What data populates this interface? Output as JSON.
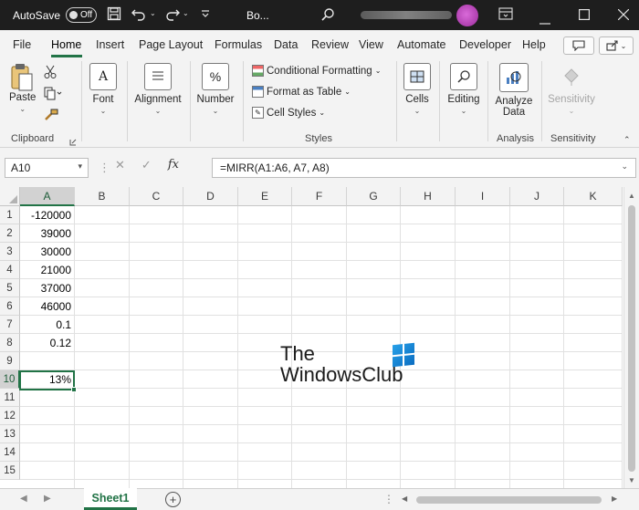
{
  "titlebar": {
    "autosave_label": "AutoSave",
    "autosave_state": "Off",
    "doc_title": "Bo...",
    "icons": [
      "save-icon",
      "undo-icon",
      "redo-icon",
      "customize-icon",
      "search-icon",
      "ribbon-display-icon",
      "minimize-icon",
      "maximize-icon",
      "close-icon"
    ]
  },
  "ribbon_tabs": [
    "File",
    "Home",
    "Insert",
    "Page Layout",
    "Formulas",
    "Data",
    "Review",
    "View",
    "Automate",
    "Developer",
    "Help"
  ],
  "active_tab": "Home",
  "ribbon": {
    "clipboard": {
      "paste": "Paste",
      "label": "Clipboard"
    },
    "font": {
      "label": "Font"
    },
    "alignment": {
      "label": "Alignment"
    },
    "number": {
      "label": "Number"
    },
    "styles": {
      "conditional_formatting": "Conditional Formatting",
      "format_as_table": "Format as Table",
      "cell_styles": "Cell Styles",
      "label": "Styles"
    },
    "cells": {
      "label": "Cells"
    },
    "editing": {
      "label": "Editing"
    },
    "analysis": {
      "analyze_data_line1": "Analyze",
      "analyze_data_line2": "Data",
      "label": "Analysis"
    },
    "sensitivity": {
      "button": "Sensitivity",
      "label": "Sensitivity"
    }
  },
  "formula_bar": {
    "name_box": "A10",
    "fx": "fx",
    "formula": "=MIRR(A1:A6, A7, A8)"
  },
  "grid": {
    "columns": [
      "A",
      "B",
      "C",
      "D",
      "E",
      "F",
      "G",
      "H",
      "I",
      "J",
      "K"
    ],
    "rows": [
      "1",
      "2",
      "3",
      "4",
      "5",
      "6",
      "7",
      "8",
      "9",
      "10",
      "11",
      "12",
      "13",
      "14",
      "15"
    ],
    "column_a_values": [
      "-120000",
      "39000",
      "30000",
      "21000",
      "37000",
      "46000",
      "0.1",
      "0.12",
      "",
      "13%",
      "",
      "",
      "",
      "",
      ""
    ],
    "selected_cell": "A10"
  },
  "watermark": {
    "line1": "The",
    "line2": "WindowsClub"
  },
  "sheets": {
    "tabs": [
      "Sheet1"
    ],
    "active": "Sheet1"
  },
  "colors": {
    "accent": "#217346",
    "titlebar": "#1e1e1e",
    "ribbon_bg": "#f3f3f3"
  }
}
